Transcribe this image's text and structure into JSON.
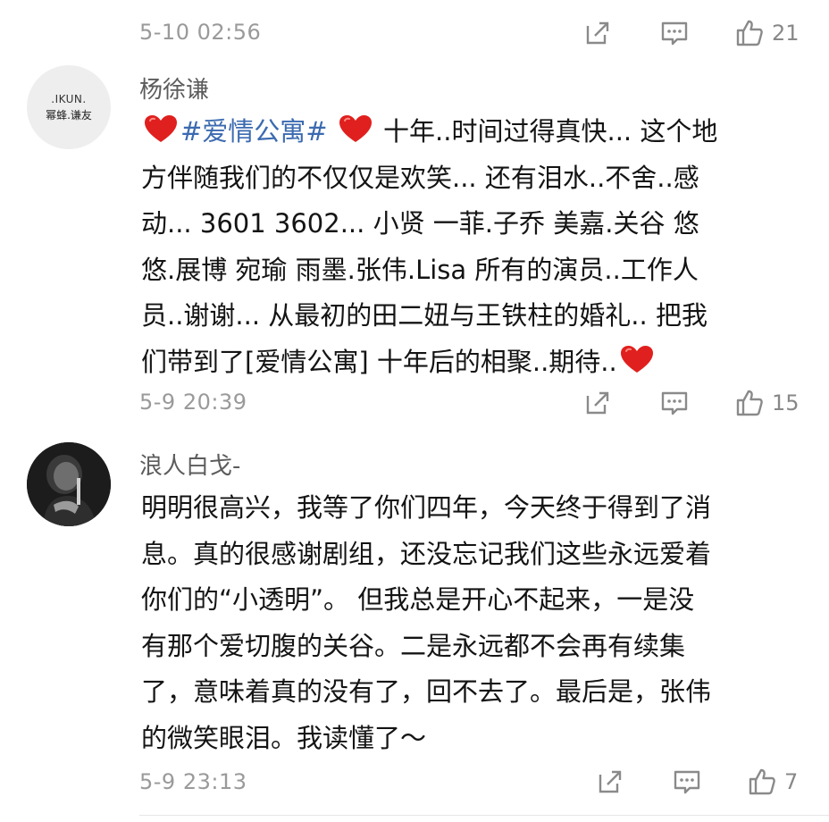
{
  "comments": [
    {
      "time": "5-10 02:56",
      "likes": "21"
    },
    {
      "user": "杨徐谦",
      "avatar_text": {
        "line1": ".IKUN.",
        "line2": "幂蜂.谦友"
      },
      "text": {
        "topic": "#爱情公寓#",
        "line1_rest": "十年..时间过得真快... 这个地",
        "line2": "方伴随我们的不仅仅是欢笑... 还有泪水..不舍..感",
        "line3": "动... 3601 3602... 小贤 一菲.子乔 美嘉.关谷 悠",
        "line4": "悠.展博 宛瑜 雨墨.张伟.Lisa 所有的演员..工作人",
        "line5": "员..谢谢... 从最初的田二妞与王铁柱的婚礼.. 把我",
        "line6": "们带到了[爱情公寓] 十年后的相聚..期待.."
      },
      "time": "5-9 20:39",
      "likes": "15"
    },
    {
      "user": "浪人白戈-",
      "text": {
        "line1": "明明很高兴，我等了你们四年，今天终于得到了消",
        "line2": "息。真的很感谢剧组，还没忘记我们这些永远爱着",
        "line3": "你们的“小透明”。 但我总是开心不起来，一是没",
        "line4": "有那个爱切腹的关谷。二是永远都不会再有续集",
        "line5": "了，意味着真的没有了，回不去了。最后是，张伟",
        "line6": "的微笑眼泪。我读懂了～"
      },
      "time": "5-9 23:13",
      "likes": "7"
    }
  ],
  "icons": [
    "share-icon",
    "comment-icon",
    "like-icon",
    "heart-emoji-icon"
  ],
  "colors": {
    "topic": "#3b6ab0",
    "heart": "#e0201e",
    "meta": "#9a9a9a"
  }
}
